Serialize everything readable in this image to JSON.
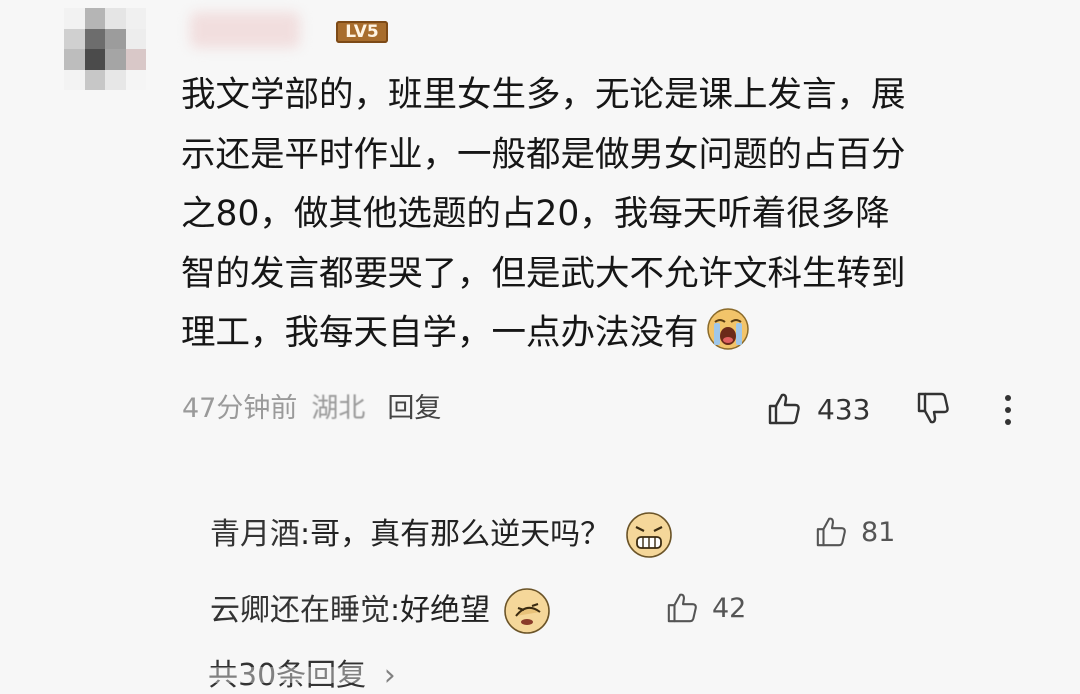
{
  "comment": {
    "level_badge": "LV5",
    "lines": [
      "我文学部的，班里女生多，无论是课上发言，展",
      "示还是平时作业，一般都是做男女问题的占百分",
      "之80，做其他选题的占20，我每天听着很多降",
      "智的发言都要哭了，但是武大不允许文科生转到",
      "理工，我每天自学，一点办法没有"
    ],
    "time": "47分钟前",
    "location": "湖北",
    "reply_label": "回复",
    "like_count": "433",
    "emoji": "crying-face-emoji"
  },
  "replies": [
    {
      "name": "青月酒",
      "separator": ": ",
      "text": "哥，真有那么逆天吗？",
      "emoji": "grimace-face-emoji",
      "likes": "81"
    },
    {
      "name": "云卿还在睡觉",
      "separator": ": ",
      "text": "好绝望",
      "emoji": "facepalm-face-emoji",
      "likes": "42"
    }
  ],
  "more_replies_label": "共30条回复",
  "colors": {
    "background": "#f7f7f7",
    "badge": "#a86d2d",
    "meta_gray": "#9a9a9a"
  }
}
